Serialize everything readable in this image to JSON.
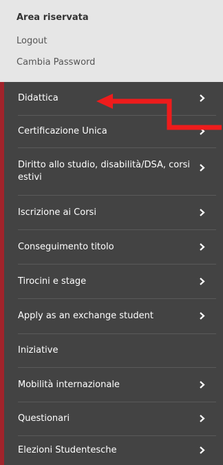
{
  "area": {
    "title": "Area riservata",
    "logout": "Logout",
    "change_password": "Cambia Password"
  },
  "menu": {
    "items": [
      {
        "label": "Didattica",
        "has_submenu": true
      },
      {
        "label": "Certificazione Unica",
        "has_submenu": true
      },
      {
        "label": "Diritto allo studio, disabilità/DSA, corsi estivi",
        "has_submenu": true
      },
      {
        "label": "Iscrizione ai Corsi",
        "has_submenu": true
      },
      {
        "label": "Conseguimento titolo",
        "has_submenu": true
      },
      {
        "label": "Tirocini e stage",
        "has_submenu": true
      },
      {
        "label": "Apply as an exchange student",
        "has_submenu": true
      },
      {
        "label": "Iniziative",
        "has_submenu": false
      },
      {
        "label": "Mobilità internazionale",
        "has_submenu": true
      },
      {
        "label": "Questionari",
        "has_submenu": true
      },
      {
        "label": "Elezioni Studentesche",
        "has_submenu": true
      }
    ]
  },
  "colors": {
    "menu_bg": "#434343",
    "accent_border": "#a1232b",
    "annotation_arrow": "#ee1c1c"
  },
  "icons": {
    "submenu": "chevron-right-icon",
    "annotation": "red-arrow-icon"
  }
}
